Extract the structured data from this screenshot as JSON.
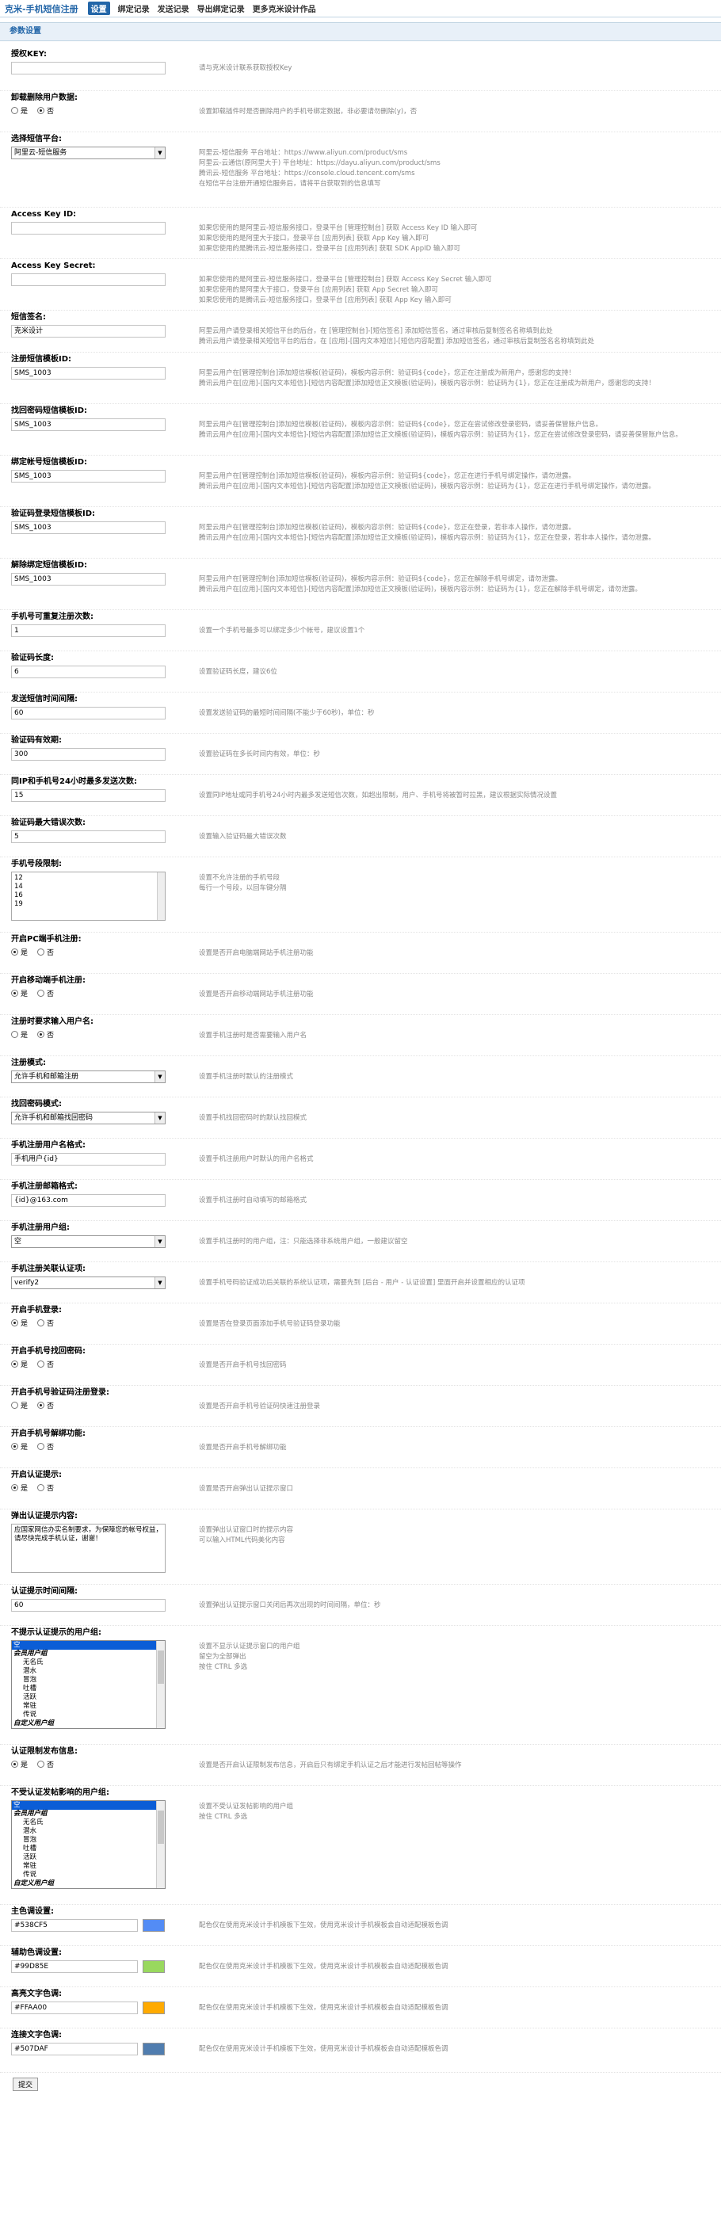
{
  "nav": {
    "brand": "克米-手机短信注册",
    "tabs": [
      "设置",
      "绑定记录",
      "发送记录",
      "导出绑定记录",
      "更多克米设计作品"
    ]
  },
  "section": {
    "title": "参数设置"
  },
  "f": {
    "appkey": {
      "title": "授权KEY:",
      "value": "",
      "desc": [
        "请与克米设计联系获取授权Key"
      ]
    },
    "delusers": {
      "title": "卸载删除用户数据:",
      "yes": "是",
      "no": "否",
      "desc": [
        "设置卸载插件时是否删除用户的手机号绑定数据，非必要请勿删除(y)，否"
      ]
    },
    "platform": {
      "title": "选择短信平台:",
      "value": "阿里云-短信服务",
      "desc": [
        "阿里云-短信服务 平台地址：https://www.aliyun.com/product/sms",
        "阿里云-云通信(原阿里大于) 平台地址：https://dayu.aliyun.com/product/sms",
        "腾讯云-短信服务 平台地址：https://console.cloud.tencent.com/sms",
        "在短信平台注册开通短信服务后，请将平台获取到的信息填写"
      ]
    },
    "akid": {
      "title": "Access Key ID:",
      "value": "",
      "desc": [
        "如果您使用的是阿里云-短信服务接口，登录平台 [管理控制台] 获取 Access Key ID 输入即可",
        "如果您使用的是阿里大于接口，登录平台 [应用列表] 获取 App Key 输入即可",
        "如果您使用的是腾讯云-短信服务接口，登录平台 [应用列表] 获取 SDK AppID 输入即可"
      ]
    },
    "aksecret": {
      "title": "Access Key Secret:",
      "value": "",
      "desc": [
        "如果您使用的是阿里云-短信服务接口，登录平台 [管理控制台] 获取 Access Key Secret 输入即可",
        "如果您使用的是阿里大于接口，登录平台 [应用列表] 获取 App Secret 输入即可",
        "如果您使用的是腾讯云-短信服务接口，登录平台 [应用列表] 获取 App Key 输入即可"
      ]
    },
    "signname": {
      "title": "短信签名:",
      "value": "克米设计",
      "desc": [
        "阿里云用户请登录相关短信平台的后台，在 [管理控制台]-[短信签名] 添加短信签名，通过审核后复制签名名称填到此处",
        "腾讯云用户请登录相关短信平台的后台，在 [应用]-[国内文本短信]-[短信内容配置] 添加短信签名，通过审核后复制签名名称填到此处"
      ]
    },
    "tpl_reg": {
      "title": "注册短信模板ID:",
      "value": "SMS_1003",
      "desc": [
        "阿里云用户在[管理控制台]添加短信模板(验证码)，模板内容示例：验证码${code}，您正在注册成为新用户，感谢您的支持！",
        "腾讯云用户在[应用]-[国内文本短信]-[短信内容配置]添加短信正文模板(验证码)，模板内容示例：验证码为{1}，您正在注册成为新用户，感谢您的支持！"
      ]
    },
    "tpl_pwd": {
      "title": "找回密码短信模板ID:",
      "value": "SMS_1003",
      "desc": [
        "阿里云用户在[管理控制台]添加短信模板(验证码)，模板内容示例：验证码${code}，您正在尝试修改登录密码，请妥善保管账户信息。",
        "腾讯云用户在[应用]-[国内文本短信]-[短信内容配置]添加短信正文模板(验证码)，模板内容示例：验证码为{1}，您正在尝试修改登录密码，请妥善保管账户信息。"
      ]
    },
    "tpl_bind": {
      "title": "绑定帐号短信模板ID:",
      "value": "SMS_1003",
      "desc": [
        "阿里云用户在[管理控制台]添加短信模板(验证码)，模板内容示例：验证码${code}，您正在进行手机号绑定操作，请勿泄露。",
        "腾讯云用户在[应用]-[国内文本短信]-[短信内容配置]添加短信正文模板(验证码)，模板内容示例：验证码为{1}，您正在进行手机号绑定操作，请勿泄露。"
      ]
    },
    "tpl_login": {
      "title": "验证码登录短信模板ID:",
      "value": "SMS_1003",
      "desc": [
        "阿里云用户在[管理控制台]添加短信模板(验证码)，模板内容示例：验证码${code}，您正在登录，若非本人操作，请勿泄露。",
        "腾讯云用户在[应用]-[国内文本短信]-[短信内容配置]添加短信正文模板(验证码)，模板内容示例：验证码为{1}，您正在登录，若非本人操作，请勿泄露。"
      ]
    },
    "tpl_unbind": {
      "title": "解除绑定短信模板ID:",
      "value": "SMS_1003",
      "desc": [
        "阿里云用户在[管理控制台]添加短信模板(验证码)，模板内容示例：验证码${code}，您正在解除手机号绑定，请勿泄露。",
        "腾讯云用户在[应用]-[国内文本短信]-[短信内容配置]添加短信正文模板(验证码)，模板内容示例：验证码为{1}，您正在解除手机号绑定，请勿泄露。"
      ]
    },
    "maxbind": {
      "title": "手机号可重复注册次数:",
      "value": "1",
      "desc": [
        "设置一个手机号最多可以绑定多少个帐号，建议设置1个"
      ]
    },
    "codelen": {
      "title": "验证码长度:",
      "value": "6",
      "desc": [
        "设置验证码长度，建议6位"
      ]
    },
    "interval": {
      "title": "发送短信时间间隔:",
      "value": "60",
      "desc": [
        "设置发送验证码的最短时间间隔(不能少于60秒)，单位：秒"
      ]
    },
    "expire": {
      "title": "验证码有效期:",
      "value": "300",
      "desc": [
        "设置验证码在多长时间内有效，单位：秒"
      ]
    },
    "daylimit": {
      "title": "同IP和手机号24小时最多发送次数:",
      "value": "15",
      "desc": [
        "设置同IP地址或同手机号24小时内最多发送短信次数，如超出限制，用户、手机号将被暂时拉黑，建议根据实际情况设置"
      ]
    },
    "maxerr": {
      "title": "验证码最大错误次数:",
      "value": "5",
      "desc": [
        "设置输入验证码最大错误次数"
      ]
    },
    "prefix": {
      "title": "手机号段限制:",
      "lines": [
        "12",
        "14",
        "16",
        "19"
      ],
      "desc": [
        "设置不允许注册的手机号段",
        "每行一个号段，以回车键分隔"
      ]
    },
    "pcreg": {
      "title": "开启PC端手机注册:",
      "yes": "是",
      "no": "否",
      "desc": [
        "设置是否开启电脑端网站手机注册功能"
      ]
    },
    "mobilereg": {
      "title": "开启移动端手机注册:",
      "yes": "是",
      "no": "否",
      "desc": [
        "设置是否开启移动端网站手机注册功能"
      ]
    },
    "requsername": {
      "title": "注册时要求输入用户名:",
      "yes": "是",
      "no": "否",
      "desc": [
        "设置手机注册时是否需要输入用户名"
      ]
    },
    "regmode": {
      "title": "注册模式:",
      "value": "允许手机和邮箱注册",
      "desc": [
        "设置手机注册时默认的注册模式"
      ]
    },
    "pwdmode": {
      "title": "找回密码模式:",
      "value": "允许手机和邮箱找回密码",
      "desc": [
        "设置手机找回密码时的默认找回模式"
      ]
    },
    "unamefmt": {
      "title": "手机注册用户名格式:",
      "value": "手机用户{id}",
      "desc": [
        "设置手机注册用户时默认的用户名格式"
      ]
    },
    "emailfmt": {
      "title": "手机注册邮箱格式:",
      "value": "{id}@163.com",
      "desc": [
        "设置手机注册时自动填写的邮箱格式"
      ]
    },
    "usergroup": {
      "title": "手机注册用户组:",
      "value": "空",
      "desc": [
        "设置手机注册时的用户组，注：只能选择非系统用户组，一般建议留空"
      ]
    },
    "verifyopt": {
      "title": "手机注册关联认证项:",
      "value": "verify2",
      "desc": [
        "设置手机号码验证成功后关联的系统认证项，需要先到 [后台 - 用户 - 认证设置] 里面开启并设置相应的认证项"
      ]
    },
    "loginreq": {
      "title": "开启手机登录:",
      "yes": "是",
      "no": "否",
      "desc": [
        "设置是否在登录页面添加手机号验证码登录功能"
      ]
    },
    "pwdreset": {
      "title": "开启手机号找回密码:",
      "yes": "是",
      "no": "否",
      "desc": [
        "设置是否开启手机号找回密码"
      ]
    },
    "codereg": {
      "title": "开启手机号验证码注册登录:",
      "yes": "是",
      "no": "否",
      "desc": [
        "设置是否开启手机号验证码快速注册登录"
      ]
    },
    "unbind": {
      "title": "开启手机号解绑功能:",
      "yes": "是",
      "no": "否",
      "desc": [
        "设置是否开启手机号解绑功能"
      ]
    },
    "authtip": {
      "title": "开启认证提示:",
      "yes": "是",
      "no": "否",
      "desc": [
        "设置是否开启弹出认证提示窗口"
      ]
    },
    "tipcontent": {
      "title": "弹出认证提示内容:",
      "text": "应国家网信办实名制要求，为保障您的帐号权益，请尽快完成手机认证，谢谢！",
      "desc": [
        "设置弹出认证窗口时的提示内容",
        "可以输入HTML代码美化内容"
      ]
    },
    "tiptime": {
      "title": "认证提示时间间隔:",
      "value": "60",
      "desc": [
        "设置弹出认证提示窗口关闭后再次出现的时间间隔，单位：秒"
      ]
    },
    "nogroups1": {
      "title": "不提示认证提示的用户组:",
      "options": [
        {
          "t": "空",
          "k": "sel1"
        },
        {
          "t": "会员用户组",
          "k": "grp"
        },
        {
          "t": "无名氏",
          "k": "ind"
        },
        {
          "t": "潜水",
          "k": "ind"
        },
        {
          "t": "冒泡",
          "k": "ind"
        },
        {
          "t": "吐槽",
          "k": "ind"
        },
        {
          "t": "活跃",
          "k": "ind"
        },
        {
          "t": "常驻",
          "k": "ind"
        },
        {
          "t": "传说",
          "k": "ind"
        },
        {
          "t": "自定义用户组",
          "k": "grp"
        }
      ],
      "desc": [
        "设置不显示认证提示窗口的用户组",
        "留空为全部弹出",
        "按住 CTRL 多选"
      ]
    },
    "nopostauth": {
      "title": "认证限制发布信息:",
      "yes": "是",
      "no": "否",
      "desc": [
        "设置是否开启认证限制发布信息，开启后只有绑定手机认证之后才能进行发帖回帖等操作"
      ]
    },
    "nogroups2": {
      "title": "不受认证发帖影响的用户组:",
      "options": [
        {
          "t": "空",
          "k": "sel1"
        },
        {
          "t": "会员用户组",
          "k": "grp"
        },
        {
          "t": "无名氏",
          "k": "ind"
        },
        {
          "t": "潜水",
          "k": "ind"
        },
        {
          "t": "冒泡",
          "k": "ind"
        },
        {
          "t": "吐槽",
          "k": "ind"
        },
        {
          "t": "活跃",
          "k": "ind"
        },
        {
          "t": "常驻",
          "k": "ind"
        },
        {
          "t": "传说",
          "k": "ind"
        },
        {
          "t": "自定义用户组",
          "k": "grp"
        }
      ],
      "desc": [
        "设置不受认证发帖影响的用户组",
        "按住 CTRL 多选"
      ]
    },
    "c_main": {
      "title": "主色调设置:",
      "value": "#538CF5",
      "color": "#538CF5",
      "desc": [
        "配色仅在使用克米设计手机模板下生效，使用克米设计手机模板会自动适配模板色调"
      ]
    },
    "c_aux": {
      "title": "辅助色调设置:",
      "value": "#99D85E",
      "color": "#99D85E",
      "desc": [
        "配色仅在使用克米设计手机模板下生效，使用克米设计手机模板会自动适配模板色调"
      ]
    },
    "c_hl": {
      "title": "高亮文字色调:",
      "value": "#FFAA00",
      "color": "#FFAA00",
      "desc": [
        "配色仅在使用克米设计手机模板下生效，使用克米设计手机模板会自动适配模板色调"
      ]
    },
    "c_link": {
      "title": "连接文字色调:",
      "value": "#507DAF",
      "color": "#507DAF",
      "desc": [
        "配色仅在使用克米设计手机模板下生效，使用克米设计手机模板会自动适配模板色调"
      ]
    }
  },
  "submit": "提交"
}
